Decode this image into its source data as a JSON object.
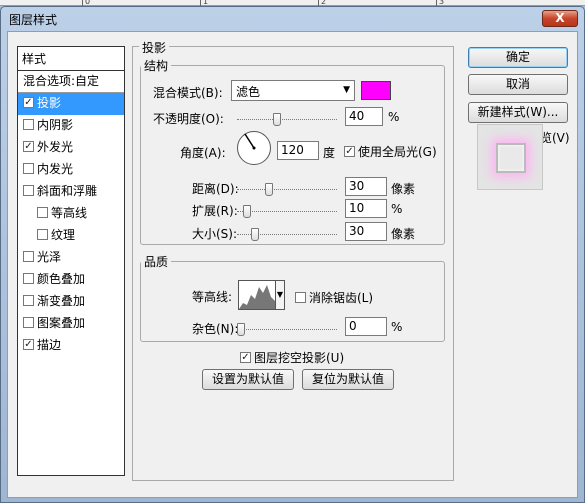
{
  "ruler": {
    "labels": [
      "0",
      "1",
      "2",
      "3"
    ]
  },
  "window": {
    "title": "图层样式",
    "close_label": "X"
  },
  "style_list": {
    "header": "样式",
    "blend_options": "混合选项:自定",
    "items": [
      {
        "label": "投影",
        "checked": true,
        "selected": true,
        "sub": false
      },
      {
        "label": "内阴影",
        "checked": false,
        "selected": false,
        "sub": false
      },
      {
        "label": "外发光",
        "checked": true,
        "selected": false,
        "sub": false
      },
      {
        "label": "内发光",
        "checked": false,
        "selected": false,
        "sub": false
      },
      {
        "label": "斜面和浮雕",
        "checked": false,
        "selected": false,
        "sub": false
      },
      {
        "label": "等高线",
        "checked": false,
        "selected": false,
        "sub": true
      },
      {
        "label": "纹理",
        "checked": false,
        "selected": false,
        "sub": true
      },
      {
        "label": "光泽",
        "checked": false,
        "selected": false,
        "sub": false
      },
      {
        "label": "颜色叠加",
        "checked": false,
        "selected": false,
        "sub": false
      },
      {
        "label": "渐变叠加",
        "checked": false,
        "selected": false,
        "sub": false
      },
      {
        "label": "图案叠加",
        "checked": false,
        "selected": false,
        "sub": false
      },
      {
        "label": "描边",
        "checked": true,
        "selected": false,
        "sub": false
      }
    ]
  },
  "panel": {
    "title": "投影",
    "structure": {
      "title": "结构",
      "blend_mode_label": "混合模式(B):",
      "blend_mode_value": "滤色",
      "shadow_color": "#ff00ff",
      "opacity_label": "不透明度(O):",
      "opacity_value": "40",
      "opacity_unit": "%",
      "angle_label": "角度(A):",
      "angle_value": "120",
      "angle_unit": "度",
      "global_light_label": "使用全局光(G)",
      "global_light_checked": true,
      "distance_label": "距离(D):",
      "distance_value": "30",
      "distance_unit": "像素",
      "spread_label": "扩展(R):",
      "spread_value": "10",
      "spread_unit": "%",
      "size_label": "大小(S):",
      "size_value": "30",
      "size_unit": "像素"
    },
    "quality": {
      "title": "品质",
      "contour_label": "等高线:",
      "antialias_label": "消除锯齿(L)",
      "antialias_checked": false,
      "noise_label": "杂色(N):",
      "noise_value": "0",
      "noise_unit": "%"
    },
    "knockout_label": "图层挖空投影(U)",
    "knockout_checked": true,
    "make_default_label": "设置为默认值",
    "reset_default_label": "复位为默认值"
  },
  "buttons": {
    "ok": "确定",
    "cancel": "取消",
    "new_style": "新建样式(W)...",
    "preview_label": "预览(V)",
    "preview_checked": false
  },
  "colors": {
    "selection": "#3399ff",
    "glow": "#ffb3f2",
    "shadow": "#ff00ff"
  }
}
